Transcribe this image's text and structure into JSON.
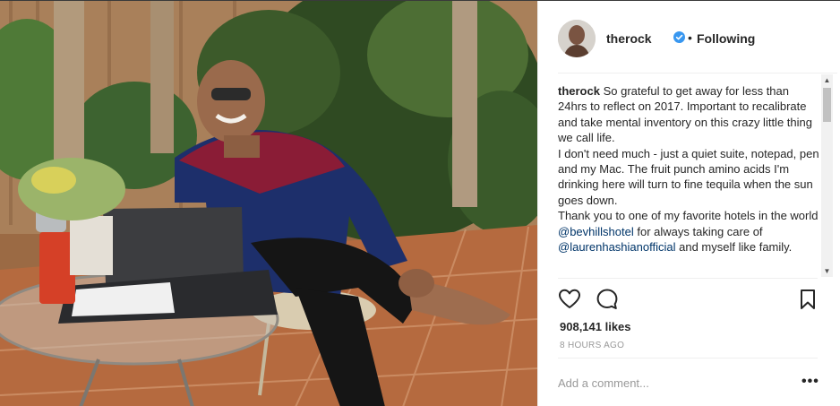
{
  "header": {
    "username": "therock",
    "separator": "•",
    "follow_status": "Following",
    "verified": true
  },
  "caption": {
    "username": "therock",
    "line1": "So grateful to get away for less than 24hrs to reflect on 2017. Important to recalibrate and take mental inventory on this crazy little thing we call life.",
    "line2": "I don't need much - just a quiet suite, notepad, pen and my Mac. The fruit punch amino acids I'm drinking here will turn to fine tequila when the sun goes down.",
    "line3_before": "Thank you to one of my favorite hotels in the world ",
    "mention1": "@bevhillshotel",
    "line3_middle": " for always taking care of ",
    "mention2": "@laurenhashianofficial",
    "line3_after": " and myself like family."
  },
  "stats": {
    "likes": "908,141 likes",
    "time": "8 HOURS AGO"
  },
  "comment": {
    "placeholder": "Add a comment..."
  },
  "icons": {
    "like": "heart-icon",
    "comment": "speech-bubble-icon",
    "save": "bookmark-icon",
    "more": "ellipsis-icon",
    "verified": "verified-badge-icon"
  },
  "colors": {
    "verified": "#3897f0",
    "mention": "#003569",
    "muted": "#999999",
    "text": "#262626"
  }
}
